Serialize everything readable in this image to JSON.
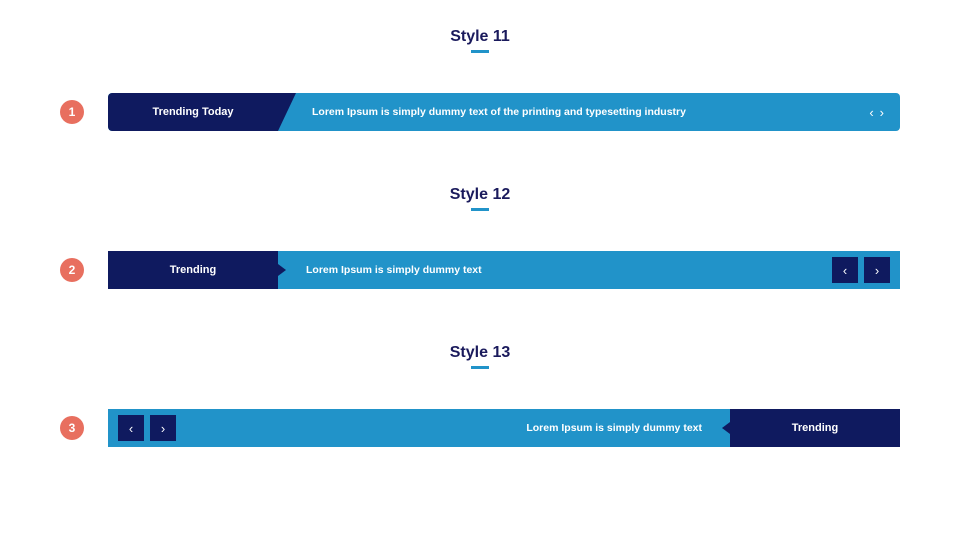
{
  "colors": {
    "badge": "#e86f5f",
    "ticker_bg": "#2193c9",
    "ticker_label_bg": "#0f1a5f",
    "title_color": "#1a1a5c"
  },
  "sections": [
    {
      "title": "Style 11",
      "badge": "1",
      "label": "Trending Today",
      "content": "Lorem Ipsum is simply dummy text of the printing and typesetting industry"
    },
    {
      "title": "Style 12",
      "badge": "2",
      "label": "Trending",
      "content": "Lorem Ipsum is simply dummy text"
    },
    {
      "title": "Style 13",
      "badge": "3",
      "label": "Trending",
      "content": "Lorem Ipsum is simply dummy text"
    }
  ]
}
